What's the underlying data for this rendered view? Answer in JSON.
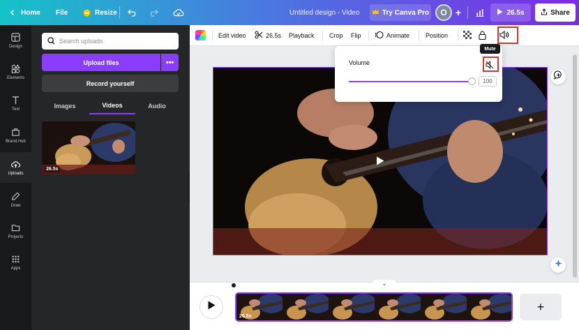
{
  "topbar": {
    "home_label": "Home",
    "file_label": "File",
    "resize_label": "Resize",
    "design_title": "Untitled design - Video",
    "try_pro_label": "Try Canva Pro",
    "avatar_initial": "O",
    "present_duration": "26.5s",
    "share_label": "Share"
  },
  "leftnav": {
    "items": [
      {
        "label": "Design"
      },
      {
        "label": "Elements"
      },
      {
        "label": "Text"
      },
      {
        "label": "Brand Hub"
      },
      {
        "label": "Uploads"
      },
      {
        "label": "Draw"
      },
      {
        "label": "Projects"
      },
      {
        "label": "Apps"
      }
    ]
  },
  "panel": {
    "search_placeholder": "Search uploads",
    "upload_label": "Upload files",
    "more_label": "•••",
    "record_label": "Record yourself",
    "tabs": [
      {
        "label": "Images"
      },
      {
        "label": "Videos"
      },
      {
        "label": "Audio"
      }
    ],
    "thumbnail_duration": "26.5s"
  },
  "toolbar": {
    "edit_video": "Edit video",
    "trim_duration": "26.5s",
    "playback": "Playback",
    "crop": "Crop",
    "flip": "Flip",
    "animate": "Animate",
    "position": "Position"
  },
  "volume": {
    "label": "Volume",
    "value": "100",
    "level_fraction": 1.0,
    "tooltip": "Mute"
  },
  "timeline": {
    "clip_duration": "26.5s",
    "add_label": "+"
  },
  "colors": {
    "accent": "#8b3dff",
    "highlight_box": "#e0302c",
    "sidebar_bg": "#18191b",
    "panel_bg": "#252627"
  }
}
